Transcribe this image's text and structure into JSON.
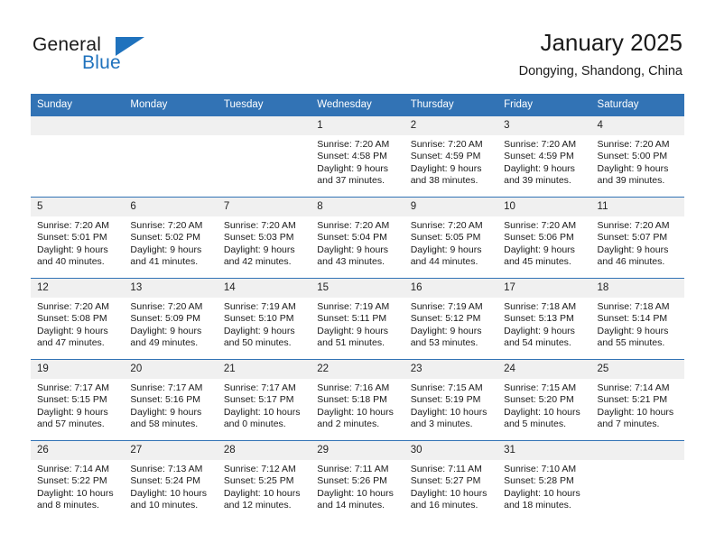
{
  "brand": {
    "word_one": "General",
    "word_two": "Blue",
    "accent_color": "#1f72bd",
    "triangle_icon": "brand-triangle-icon"
  },
  "header": {
    "title": "January 2025",
    "location": "Dongying, Shandong, China",
    "header_bg_color": "#3273b5",
    "daynum_bg_color": "#f0f0f0"
  },
  "weekday_headers": [
    "Sunday",
    "Monday",
    "Tuesday",
    "Wednesday",
    "Thursday",
    "Friday",
    "Saturday"
  ],
  "labels": {
    "sunrise_prefix": "Sunrise:",
    "sunset_prefix": "Sunset:",
    "daylight_prefix": "Daylight:"
  },
  "weeks": [
    [
      {
        "day": "",
        "empty": true
      },
      {
        "day": "",
        "empty": true
      },
      {
        "day": "",
        "empty": true
      },
      {
        "day": "1",
        "sunrise": "Sunrise: 7:20 AM",
        "sunset": "Sunset: 4:58 PM",
        "daylight_line1": "Daylight: 9 hours",
        "daylight_line2": "and 37 minutes."
      },
      {
        "day": "2",
        "sunrise": "Sunrise: 7:20 AM",
        "sunset": "Sunset: 4:59 PM",
        "daylight_line1": "Daylight: 9 hours",
        "daylight_line2": "and 38 minutes."
      },
      {
        "day": "3",
        "sunrise": "Sunrise: 7:20 AM",
        "sunset": "Sunset: 4:59 PM",
        "daylight_line1": "Daylight: 9 hours",
        "daylight_line2": "and 39 minutes."
      },
      {
        "day": "4",
        "sunrise": "Sunrise: 7:20 AM",
        "sunset": "Sunset: 5:00 PM",
        "daylight_line1": "Daylight: 9 hours",
        "daylight_line2": "and 39 minutes."
      }
    ],
    [
      {
        "day": "5",
        "sunrise": "Sunrise: 7:20 AM",
        "sunset": "Sunset: 5:01 PM",
        "daylight_line1": "Daylight: 9 hours",
        "daylight_line2": "and 40 minutes."
      },
      {
        "day": "6",
        "sunrise": "Sunrise: 7:20 AM",
        "sunset": "Sunset: 5:02 PM",
        "daylight_line1": "Daylight: 9 hours",
        "daylight_line2": "and 41 minutes."
      },
      {
        "day": "7",
        "sunrise": "Sunrise: 7:20 AM",
        "sunset": "Sunset: 5:03 PM",
        "daylight_line1": "Daylight: 9 hours",
        "daylight_line2": "and 42 minutes."
      },
      {
        "day": "8",
        "sunrise": "Sunrise: 7:20 AM",
        "sunset": "Sunset: 5:04 PM",
        "daylight_line1": "Daylight: 9 hours",
        "daylight_line2": "and 43 minutes."
      },
      {
        "day": "9",
        "sunrise": "Sunrise: 7:20 AM",
        "sunset": "Sunset: 5:05 PM",
        "daylight_line1": "Daylight: 9 hours",
        "daylight_line2": "and 44 minutes."
      },
      {
        "day": "10",
        "sunrise": "Sunrise: 7:20 AM",
        "sunset": "Sunset: 5:06 PM",
        "daylight_line1": "Daylight: 9 hours",
        "daylight_line2": "and 45 minutes."
      },
      {
        "day": "11",
        "sunrise": "Sunrise: 7:20 AM",
        "sunset": "Sunset: 5:07 PM",
        "daylight_line1": "Daylight: 9 hours",
        "daylight_line2": "and 46 minutes."
      }
    ],
    [
      {
        "day": "12",
        "sunrise": "Sunrise: 7:20 AM",
        "sunset": "Sunset: 5:08 PM",
        "daylight_line1": "Daylight: 9 hours",
        "daylight_line2": "and 47 minutes."
      },
      {
        "day": "13",
        "sunrise": "Sunrise: 7:20 AM",
        "sunset": "Sunset: 5:09 PM",
        "daylight_line1": "Daylight: 9 hours",
        "daylight_line2": "and 49 minutes."
      },
      {
        "day": "14",
        "sunrise": "Sunrise: 7:19 AM",
        "sunset": "Sunset: 5:10 PM",
        "daylight_line1": "Daylight: 9 hours",
        "daylight_line2": "and 50 minutes."
      },
      {
        "day": "15",
        "sunrise": "Sunrise: 7:19 AM",
        "sunset": "Sunset: 5:11 PM",
        "daylight_line1": "Daylight: 9 hours",
        "daylight_line2": "and 51 minutes."
      },
      {
        "day": "16",
        "sunrise": "Sunrise: 7:19 AM",
        "sunset": "Sunset: 5:12 PM",
        "daylight_line1": "Daylight: 9 hours",
        "daylight_line2": "and 53 minutes."
      },
      {
        "day": "17",
        "sunrise": "Sunrise: 7:18 AM",
        "sunset": "Sunset: 5:13 PM",
        "daylight_line1": "Daylight: 9 hours",
        "daylight_line2": "and 54 minutes."
      },
      {
        "day": "18",
        "sunrise": "Sunrise: 7:18 AM",
        "sunset": "Sunset: 5:14 PM",
        "daylight_line1": "Daylight: 9 hours",
        "daylight_line2": "and 55 minutes."
      }
    ],
    [
      {
        "day": "19",
        "sunrise": "Sunrise: 7:17 AM",
        "sunset": "Sunset: 5:15 PM",
        "daylight_line1": "Daylight: 9 hours",
        "daylight_line2": "and 57 minutes."
      },
      {
        "day": "20",
        "sunrise": "Sunrise: 7:17 AM",
        "sunset": "Sunset: 5:16 PM",
        "daylight_line1": "Daylight: 9 hours",
        "daylight_line2": "and 58 minutes."
      },
      {
        "day": "21",
        "sunrise": "Sunrise: 7:17 AM",
        "sunset": "Sunset: 5:17 PM",
        "daylight_line1": "Daylight: 10 hours",
        "daylight_line2": "and 0 minutes."
      },
      {
        "day": "22",
        "sunrise": "Sunrise: 7:16 AM",
        "sunset": "Sunset: 5:18 PM",
        "daylight_line1": "Daylight: 10 hours",
        "daylight_line2": "and 2 minutes."
      },
      {
        "day": "23",
        "sunrise": "Sunrise: 7:15 AM",
        "sunset": "Sunset: 5:19 PM",
        "daylight_line1": "Daylight: 10 hours",
        "daylight_line2": "and 3 minutes."
      },
      {
        "day": "24",
        "sunrise": "Sunrise: 7:15 AM",
        "sunset": "Sunset: 5:20 PM",
        "daylight_line1": "Daylight: 10 hours",
        "daylight_line2": "and 5 minutes."
      },
      {
        "day": "25",
        "sunrise": "Sunrise: 7:14 AM",
        "sunset": "Sunset: 5:21 PM",
        "daylight_line1": "Daylight: 10 hours",
        "daylight_line2": "and 7 minutes."
      }
    ],
    [
      {
        "day": "26",
        "sunrise": "Sunrise: 7:14 AM",
        "sunset": "Sunset: 5:22 PM",
        "daylight_line1": "Daylight: 10 hours",
        "daylight_line2": "and 8 minutes."
      },
      {
        "day": "27",
        "sunrise": "Sunrise: 7:13 AM",
        "sunset": "Sunset: 5:24 PM",
        "daylight_line1": "Daylight: 10 hours",
        "daylight_line2": "and 10 minutes."
      },
      {
        "day": "28",
        "sunrise": "Sunrise: 7:12 AM",
        "sunset": "Sunset: 5:25 PM",
        "daylight_line1": "Daylight: 10 hours",
        "daylight_line2": "and 12 minutes."
      },
      {
        "day": "29",
        "sunrise": "Sunrise: 7:11 AM",
        "sunset": "Sunset: 5:26 PM",
        "daylight_line1": "Daylight: 10 hours",
        "daylight_line2": "and 14 minutes."
      },
      {
        "day": "30",
        "sunrise": "Sunrise: 7:11 AM",
        "sunset": "Sunset: 5:27 PM",
        "daylight_line1": "Daylight: 10 hours",
        "daylight_line2": "and 16 minutes."
      },
      {
        "day": "31",
        "sunrise": "Sunrise: 7:10 AM",
        "sunset": "Sunset: 5:28 PM",
        "daylight_line1": "Daylight: 10 hours",
        "daylight_line2": "and 18 minutes."
      },
      {
        "day": "",
        "empty": true
      }
    ]
  ]
}
